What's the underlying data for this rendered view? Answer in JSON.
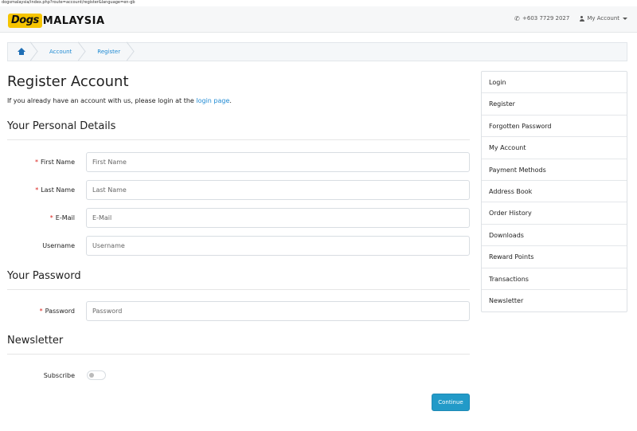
{
  "url": "dogsmalaysia/index.php?route=account/register&language=en-gb",
  "header": {
    "logo_badge": "Dogs",
    "logo_text": "MALAYSIA",
    "phone": "+603 7729 2027",
    "account_label": "My Account"
  },
  "breadcrumb": {
    "items": [
      "Account",
      "Register"
    ]
  },
  "page": {
    "title": "Register Account",
    "intro_prefix": "If you already have an account with us, please login at the ",
    "intro_link": "login page",
    "intro_suffix": "."
  },
  "sections": {
    "personal": "Your Personal Details",
    "password": "Your Password",
    "newsletter": "Newsletter"
  },
  "fields": {
    "firstname": {
      "label": "First Name",
      "placeholder": "First Name",
      "value": ""
    },
    "lastname": {
      "label": "Last Name",
      "placeholder": "Last Name",
      "value": ""
    },
    "email": {
      "label": "E-Mail",
      "placeholder": "E-Mail",
      "value": ""
    },
    "username": {
      "label": "Username",
      "placeholder": "Username",
      "value": ""
    },
    "password": {
      "label": "Password",
      "placeholder": "Password",
      "value": ""
    },
    "subscribe": {
      "label": "Subscribe",
      "checked": false
    }
  },
  "required_mark": "*",
  "continue_label": "Continue",
  "sidebar": {
    "items": [
      {
        "label": "Login"
      },
      {
        "label": "Register"
      },
      {
        "label": "Forgotten Password"
      },
      {
        "label": "My Account"
      },
      {
        "label": "Payment Methods"
      },
      {
        "label": "Address Book"
      },
      {
        "label": "Order History"
      },
      {
        "label": "Downloads"
      },
      {
        "label": "Reward Points"
      },
      {
        "label": "Transactions"
      },
      {
        "label": "Newsletter"
      }
    ]
  },
  "colors": {
    "link": "#1f8ad3",
    "button": "#229ac8",
    "required": "#d9221c",
    "logo_badge": "#f5c400"
  }
}
